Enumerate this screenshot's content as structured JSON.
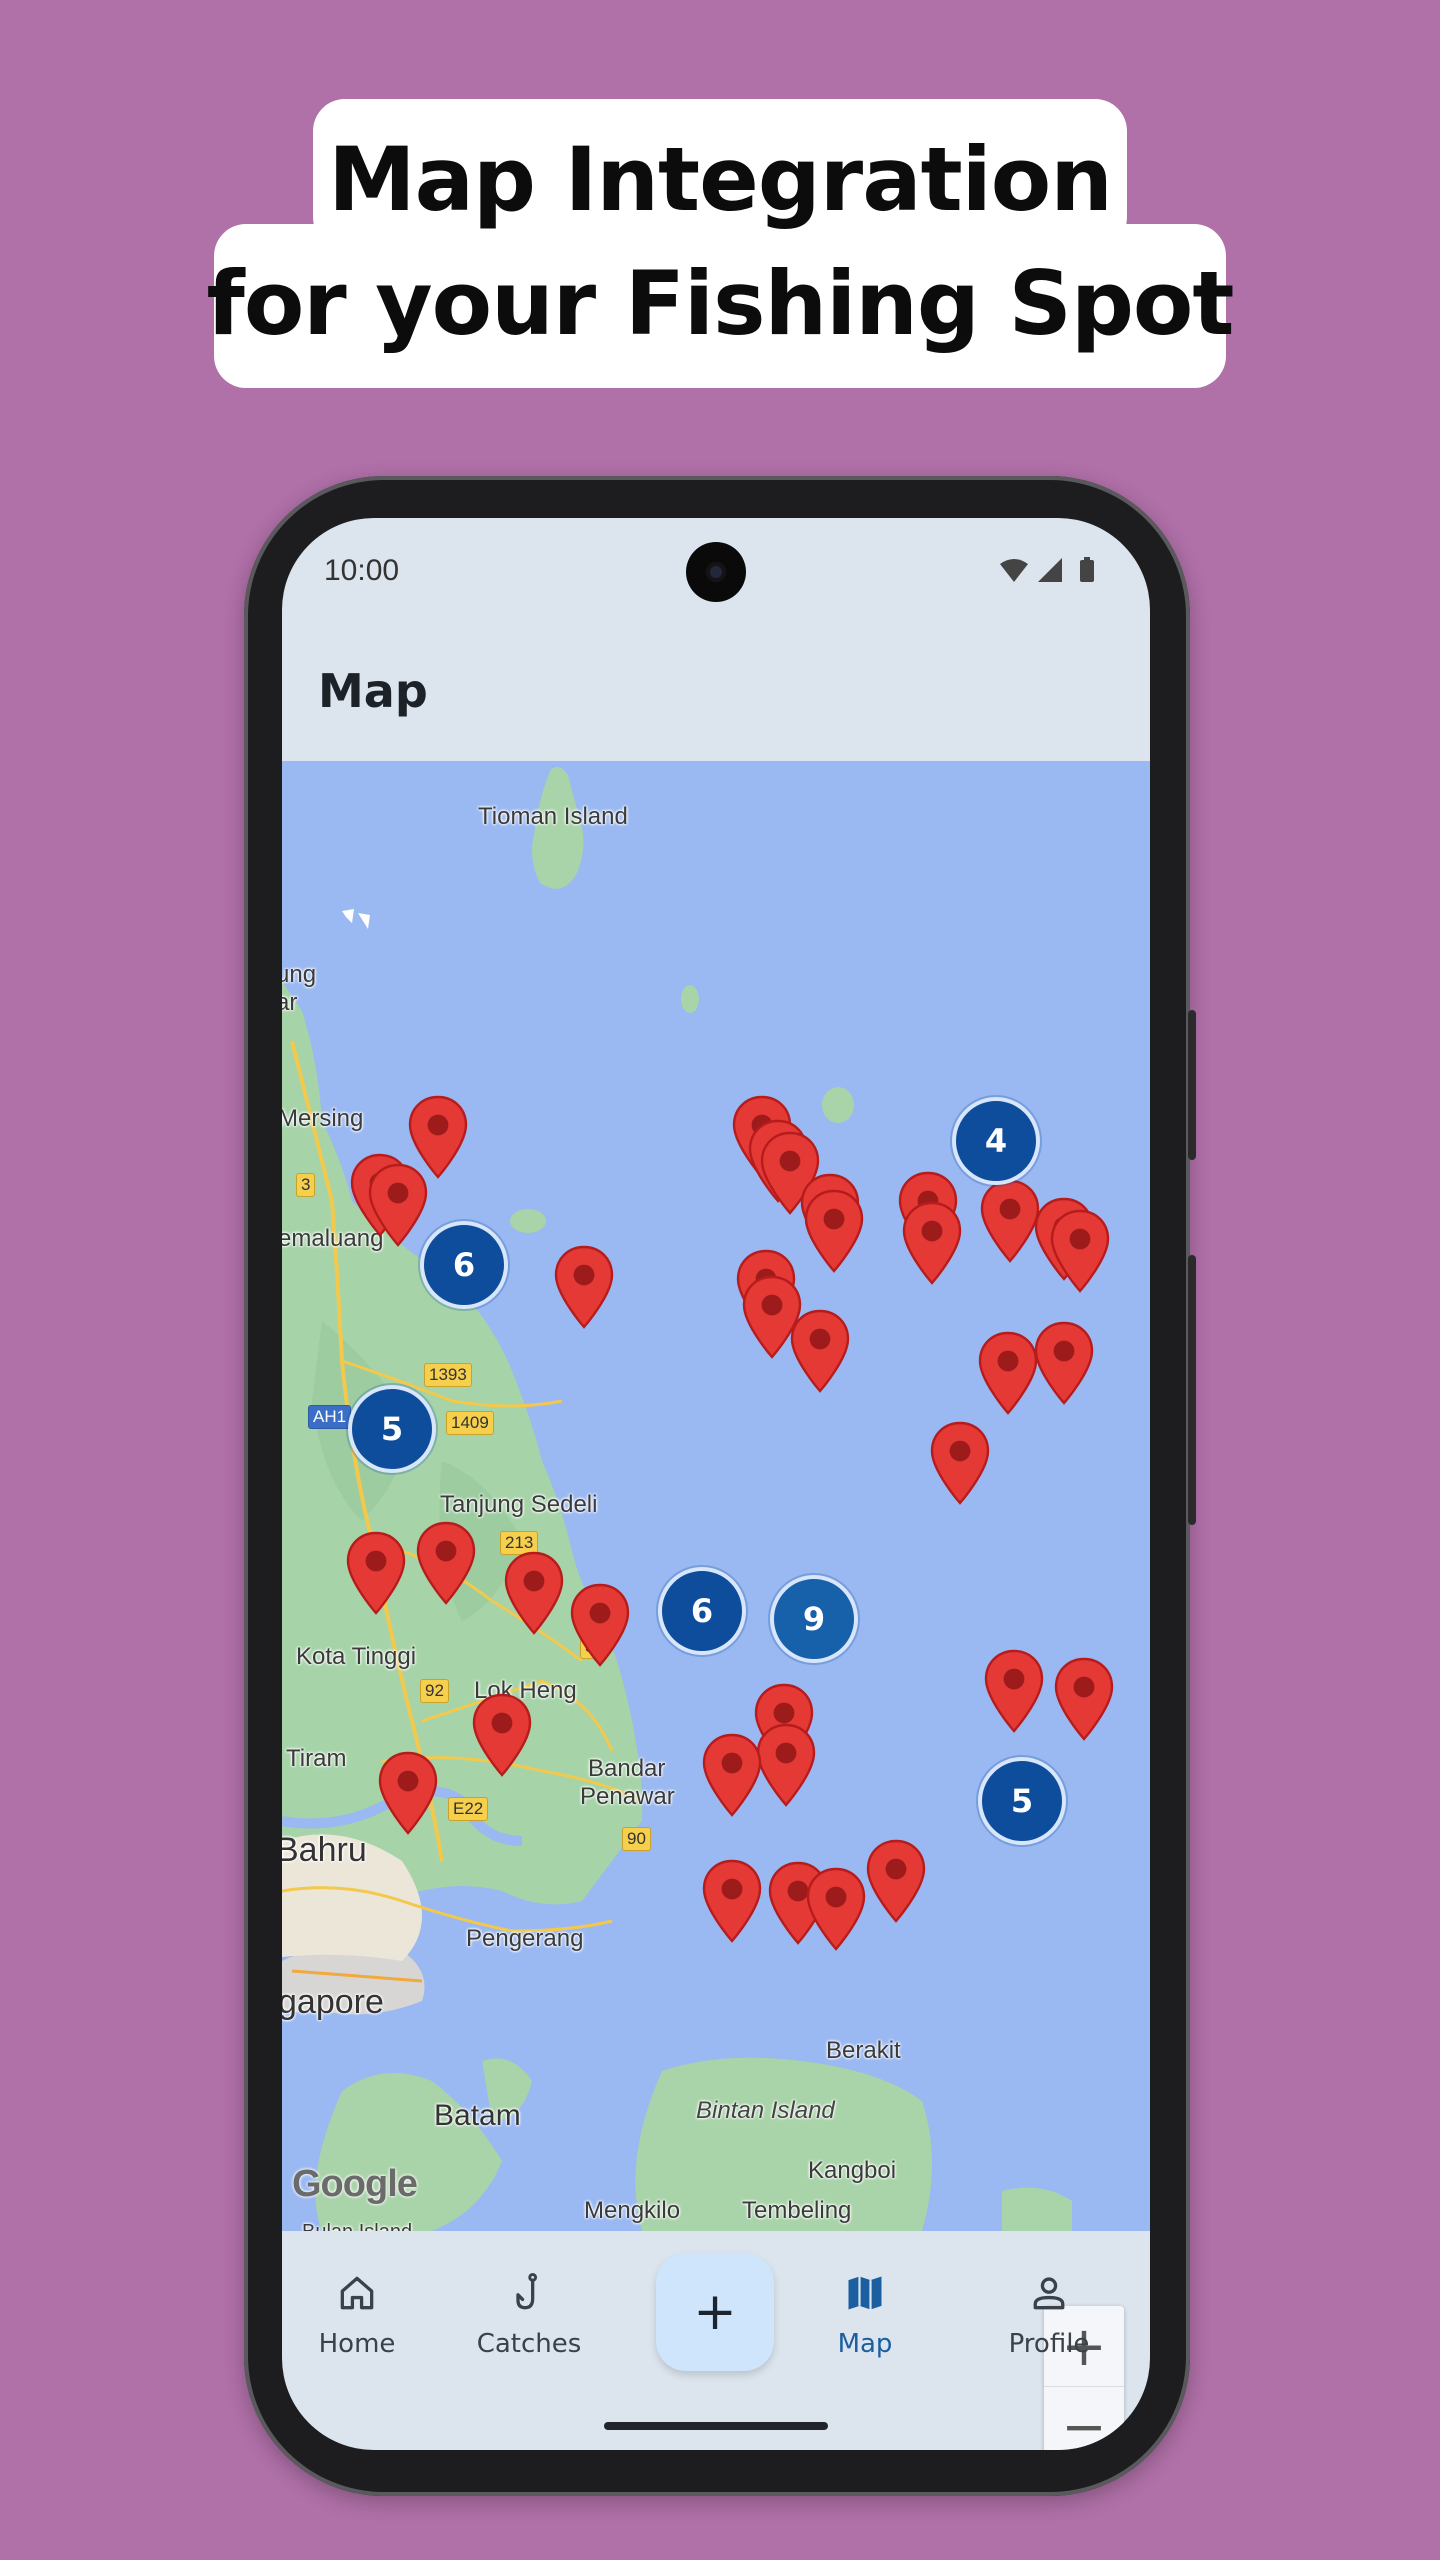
{
  "promo": {
    "headline_line1": "Map Integration",
    "headline_line2": "for your Fishing Spot",
    "background_color": "#b070a8"
  },
  "status_bar": {
    "time": "10:00",
    "icons": [
      "wifi-icon",
      "cell-signal-icon",
      "battery-icon"
    ]
  },
  "app_bar": {
    "title": "Map"
  },
  "map": {
    "labels": {
      "tioman": "Tioman Island",
      "mersing": "Mersing",
      "endau_fragment": "ung",
      "endau_fragment2": "ar",
      "jemaluang": "emaluang",
      "tanjung_sedeli": "Tanjung Sedeli",
      "kota_tinggi": "Kota Tinggi",
      "lok_heng": "Lok Heng",
      "tiram": "Tiram",
      "bandar_penawar_1": "Bandar",
      "bandar_penawar_2": "Penawar",
      "johor_bahru": "Bahru",
      "pengerang": "Pengerang",
      "singapore": "gapore",
      "berakit": "Berakit",
      "bintan": "Bintan Island",
      "batam": "Batam",
      "kangboi": "Kangboi",
      "mengkilo": "Mengkilo",
      "tembeling": "Tembeling",
      "bulan_island": "Bulan Island"
    },
    "road_shields": {
      "r1393": "1393",
      "r1409": "1409",
      "ah": "AH1",
      "r213": "213",
      "r92": "92",
      "e22": "E22",
      "r90": "90",
      "r3": "3",
      "r3b": "3"
    },
    "clusters": [
      {
        "count": "4"
      },
      {
        "count": "6"
      },
      {
        "count": "5"
      },
      {
        "count": "6"
      },
      {
        "count": "9"
      },
      {
        "count": "5"
      }
    ],
    "attribution": "Google",
    "zoom_in": "+",
    "zoom_out": "−",
    "marker_color": "#e53935",
    "cluster_color": "#0d4d9c"
  },
  "bottom_nav": {
    "items": [
      {
        "label": "Home",
        "icon": "home-icon"
      },
      {
        "label": "Catches",
        "icon": "fishing-hook-icon"
      },
      {
        "label": "Map",
        "icon": "map-icon",
        "active": true
      },
      {
        "label": "Profile",
        "icon": "person-icon"
      }
    ],
    "fab_label": "+",
    "active_color": "#1b5fa1"
  }
}
